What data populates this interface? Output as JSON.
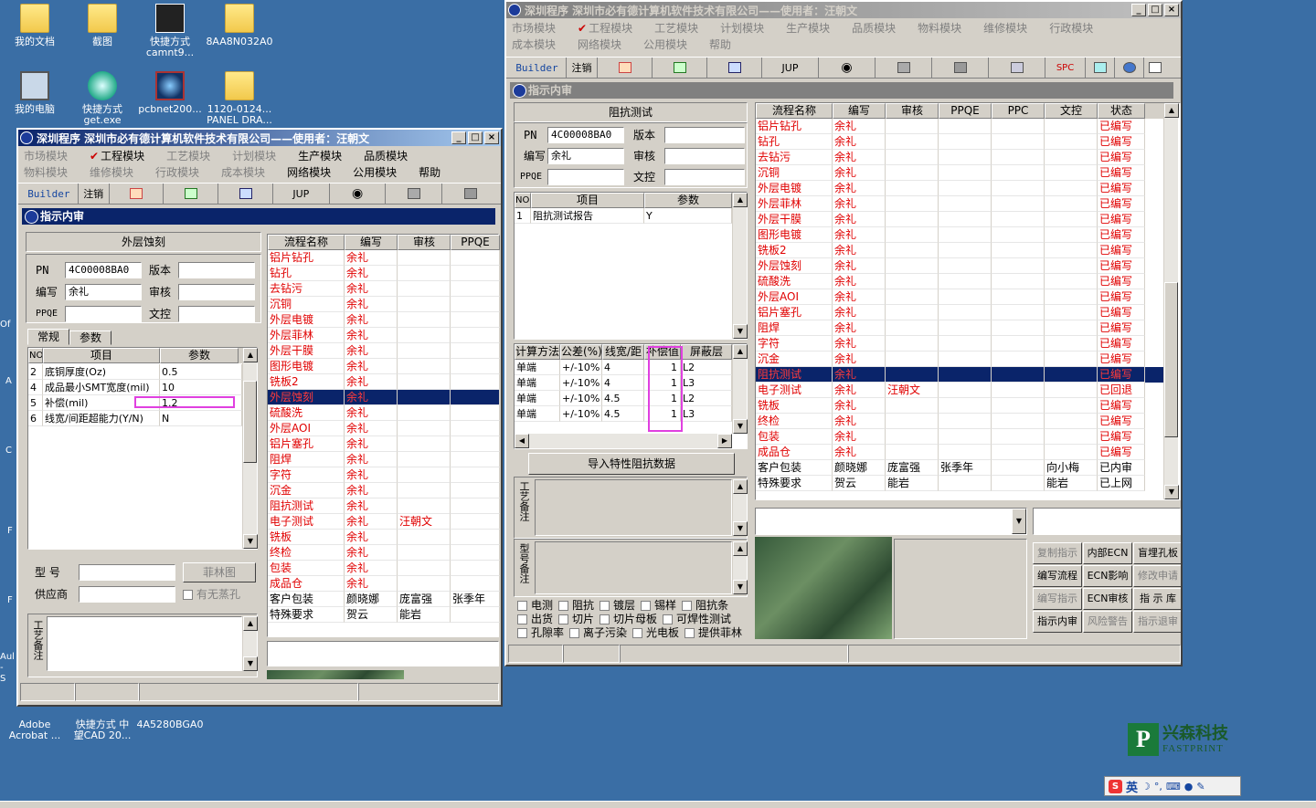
{
  "desktop": {
    "icons": [
      {
        "label": "我的文档"
      },
      {
        "label": "截图"
      },
      {
        "label": "快捷方式",
        "label2": "camnt9..."
      },
      {
        "label": "8AA8N032A0"
      },
      {
        "label": "我的电脑"
      },
      {
        "label": "快捷方式",
        "label2": "get.exe"
      },
      {
        "label": "pcbnet200..."
      },
      {
        "label": "1120-0124...",
        "label2": "PANEL DRA..."
      },
      {
        "label": "Adobe",
        "label2": "Acrobat ..."
      },
      {
        "label": "快捷方式 中",
        "label2": "望CAD 20..."
      },
      {
        "label": "4A5280BGA0"
      }
    ],
    "edge_text": [
      "Of",
      "A",
      "C",
      "F",
      "F",
      "Aul",
      "- S"
    ],
    "logo": {
      "cn": "兴森科技",
      "en": "FASTPRINT"
    },
    "ime": {
      "label": "英"
    }
  },
  "win1": {
    "title": "深圳程序    深圳市必有德计算机软件技术有限公司——使用者：汪朝文",
    "menu": [
      {
        "t": "市场模块",
        "d": true
      },
      {
        "t": "工程模块",
        "d": false,
        "check": true
      },
      {
        "t": "工艺模块",
        "d": true
      },
      {
        "t": "计划模块",
        "d": true
      },
      {
        "t": "生产模块",
        "d": false
      },
      {
        "t": "品质模块",
        "d": false
      },
      {
        "t": "物料模块",
        "d": true
      },
      {
        "t": "维修模块",
        "d": true
      },
      {
        "t": "行政模块",
        "d": true
      },
      {
        "t": "成本模块",
        "d": true
      },
      {
        "t": "网络模块",
        "d": false
      },
      {
        "t": "公用模块",
        "d": false
      },
      {
        "t": "帮助",
        "d": false
      }
    ],
    "toolbar": {
      "builder": "Builder",
      "logout": "注销",
      "jup": "JUP"
    },
    "panel_title": "指示内审",
    "left": {
      "heading": "外层蚀刻",
      "pn_label": "PN",
      "pn": "4C00008BA0",
      "ver_label": "版本",
      "ver": "",
      "author_label": "编写",
      "author": "余礼",
      "review_label": "审核",
      "review": "",
      "ppqe_label": "PPQE",
      "ppqe": "",
      "ctrl_label": "文控",
      "ctrl": "",
      "tabs": [
        "常规",
        "参数"
      ],
      "grid_headers": [
        "NO",
        "项目",
        "参数"
      ],
      "grid": [
        [
          "2",
          "底铜厚度(Oz)",
          "0.5"
        ],
        [
          "4",
          "成品最小SMT宽度(mil)",
          "10"
        ],
        [
          "5",
          "补偿(mil)",
          "1.2"
        ],
        [
          "6",
          "线宽/间距超能力(Y/N)",
          "N"
        ]
      ],
      "model_label": "型  号",
      "model": "",
      "film_btn": "菲林图",
      "supplier_label": "供应商",
      "supplier": "",
      "no_hole": "有无蒸孔",
      "craft_note": "工艺备注"
    },
    "flow_headers": [
      "流程名称",
      "编写",
      "审核",
      "PPQE"
    ],
    "flows": [
      [
        "铝片钻孔",
        "余礼",
        "",
        ""
      ],
      [
        "钻孔",
        "余礼",
        "",
        ""
      ],
      [
        "去钻污",
        "余礼",
        "",
        ""
      ],
      [
        "沉铜",
        "余礼",
        "",
        ""
      ],
      [
        "外层电镀",
        "余礼",
        "",
        ""
      ],
      [
        "外层菲林",
        "余礼",
        "",
        ""
      ],
      [
        "外层干膜",
        "余礼",
        "",
        ""
      ],
      [
        "图形电镀",
        "余礼",
        "",
        ""
      ],
      [
        "铣板2",
        "余礼",
        "",
        ""
      ],
      [
        "外层蚀刻",
        "余礼",
        "",
        ""
      ],
      [
        "硫酸洗",
        "余礼",
        "",
        ""
      ],
      [
        "外层AOI",
        "余礼",
        "",
        ""
      ],
      [
        "铝片塞孔",
        "余礼",
        "",
        ""
      ],
      [
        "阻焊",
        "余礼",
        "",
        ""
      ],
      [
        "字符",
        "余礼",
        "",
        ""
      ],
      [
        "沉金",
        "余礼",
        "",
        ""
      ],
      [
        "阻抗测试",
        "余礼",
        "",
        ""
      ],
      [
        "电子测试",
        "余礼",
        "汪朝文",
        ""
      ],
      [
        "铣板",
        "余礼",
        "",
        ""
      ],
      [
        "终检",
        "余礼",
        "",
        ""
      ],
      [
        "包装",
        "余礼",
        "",
        ""
      ],
      [
        "成品仓",
        "余礼",
        "",
        ""
      ],
      [
        "客户包装",
        "颜晓娜",
        "庞富强",
        "张季年"
      ],
      [
        "特殊要求",
        "贺云",
        "能岩",
        ""
      ]
    ],
    "selected_flow": 9
  },
  "win2": {
    "title": "深圳程序    深圳市必有德计算机软件技术有限公司——使用者：汪朝文",
    "menu": [
      {
        "t": "市场模块",
        "d": true
      },
      {
        "t": "工程模块",
        "d": true,
        "check": true
      },
      {
        "t": "工艺模块",
        "d": true
      },
      {
        "t": "计划模块",
        "d": true
      },
      {
        "t": "生产模块",
        "d": true
      },
      {
        "t": "品质模块",
        "d": true
      },
      {
        "t": "物料模块",
        "d": true
      },
      {
        "t": "维修模块",
        "d": true
      },
      {
        "t": "行政模块",
        "d": true
      },
      {
        "t": "成本模块",
        "d": true
      },
      {
        "t": "网络模块",
        "d": true
      },
      {
        "t": "公用模块",
        "d": true
      },
      {
        "t": "帮助",
        "d": true
      }
    ],
    "toolbar": {
      "builder": "Builder",
      "logout": "注销",
      "jup": "JUP",
      "spc": "SPC"
    },
    "panel_title": "指示内审",
    "left": {
      "heading": "阻抗测试",
      "pn_label": "PN",
      "pn": "4C00008BA0",
      "ver_label": "版本",
      "ver": "",
      "author_label": "编写",
      "author": "余礼",
      "review_label": "审核",
      "review": "",
      "ppqe_label": "PPQE",
      "ppqe": "",
      "ctrl_label": "文控",
      "ctrl": "",
      "grid_headers": [
        "NO",
        "项目",
        "参数"
      ],
      "grid": [
        [
          "1",
          "阻抗测试报告",
          "Y"
        ]
      ],
      "imp_headers": [
        "计算方法",
        "公差(%)",
        "线宽/距",
        "补偿值",
        "屏蔽层"
      ],
      "imp": [
        [
          "单端",
          "+/-10%",
          "4",
          "1",
          "L2"
        ],
        [
          "单端",
          "+/-10%",
          "4",
          "1",
          "L3"
        ],
        [
          "单端",
          "+/-10%",
          "4.5",
          "1",
          "L2"
        ],
        [
          "单端",
          "+/-10%",
          "4.5",
          "1",
          "L3"
        ]
      ],
      "import_btn": "导入特性阻抗数据",
      "craft_note": "工艺备注",
      "model_note": "型号备注",
      "checks": [
        [
          "电测",
          "阻抗",
          "镀层",
          "锡样",
          "阻抗条"
        ],
        [
          "出货",
          "切片",
          "切片母板",
          "可焊性测试"
        ],
        [
          "孔隙率",
          "离子污染",
          "光电板",
          "提供菲林"
        ]
      ]
    },
    "flow_headers": [
      "流程名称",
      "编写",
      "审核",
      "PPQE",
      "PPC",
      "文控",
      "状态"
    ],
    "flows": [
      [
        "铝片钻孔",
        "余礼",
        "",
        "",
        "",
        "",
        "已编写"
      ],
      [
        "钻孔",
        "余礼",
        "",
        "",
        "",
        "",
        "已编写"
      ],
      [
        "去钻污",
        "余礼",
        "",
        "",
        "",
        "",
        "已编写"
      ],
      [
        "沉铜",
        "余礼",
        "",
        "",
        "",
        "",
        "已编写"
      ],
      [
        "外层电镀",
        "余礼",
        "",
        "",
        "",
        "",
        "已编写"
      ],
      [
        "外层菲林",
        "余礼",
        "",
        "",
        "",
        "",
        "已编写"
      ],
      [
        "外层干膜",
        "余礼",
        "",
        "",
        "",
        "",
        "已编写"
      ],
      [
        "图形电镀",
        "余礼",
        "",
        "",
        "",
        "",
        "已编写"
      ],
      [
        "铣板2",
        "余礼",
        "",
        "",
        "",
        "",
        "已编写"
      ],
      [
        "外层蚀刻",
        "余礼",
        "",
        "",
        "",
        "",
        "已编写"
      ],
      [
        "硫酸洗",
        "余礼",
        "",
        "",
        "",
        "",
        "已编写"
      ],
      [
        "外层AOI",
        "余礼",
        "",
        "",
        "",
        "",
        "已编写"
      ],
      [
        "铝片塞孔",
        "余礼",
        "",
        "",
        "",
        "",
        "已编写"
      ],
      [
        "阻焊",
        "余礼",
        "",
        "",
        "",
        "",
        "已编写"
      ],
      [
        "字符",
        "余礼",
        "",
        "",
        "",
        "",
        "已编写"
      ],
      [
        "沉金",
        "余礼",
        "",
        "",
        "",
        "",
        "已编写"
      ],
      [
        "阻抗测试",
        "余礼",
        "",
        "",
        "",
        "",
        "已编写"
      ],
      [
        "电子测试",
        "余礼",
        "汪朝文",
        "",
        "",
        "",
        "已回退"
      ],
      [
        "铣板",
        "余礼",
        "",
        "",
        "",
        "",
        "已编写"
      ],
      [
        "终检",
        "余礼",
        "",
        "",
        "",
        "",
        "已编写"
      ],
      [
        "包装",
        "余礼",
        "",
        "",
        "",
        "",
        "已编写"
      ],
      [
        "成品仓",
        "余礼",
        "",
        "",
        "",
        "",
        "已编写"
      ],
      [
        "客户包装",
        "颜晓娜",
        "庞富强",
        "张季年",
        "",
        "向小梅",
        "已内审"
      ],
      [
        "特殊要求",
        "贺云",
        "能岩",
        "",
        "",
        "能岩",
        "已上网"
      ]
    ],
    "selected_flow": 16,
    "buttons": [
      [
        "复制指示",
        "内部ECN",
        "盲埋孔板"
      ],
      [
        "编写流程",
        "ECN影响",
        "修改申请"
      ],
      [
        "编写指示",
        "ECN审核",
        "指 示 库"
      ],
      [
        "指示内审",
        "风险警告",
        "指示退审"
      ]
    ],
    "buttons_disabled": [
      [
        true,
        false,
        false
      ],
      [
        false,
        false,
        true
      ],
      [
        true,
        false,
        false
      ],
      [
        false,
        true,
        true
      ]
    ]
  },
  "colors": {
    "desktop": "#3a6ea5",
    "title_active": "#0a246a",
    "flow_red": "#e00000",
    "highlight": "#e040e0"
  }
}
